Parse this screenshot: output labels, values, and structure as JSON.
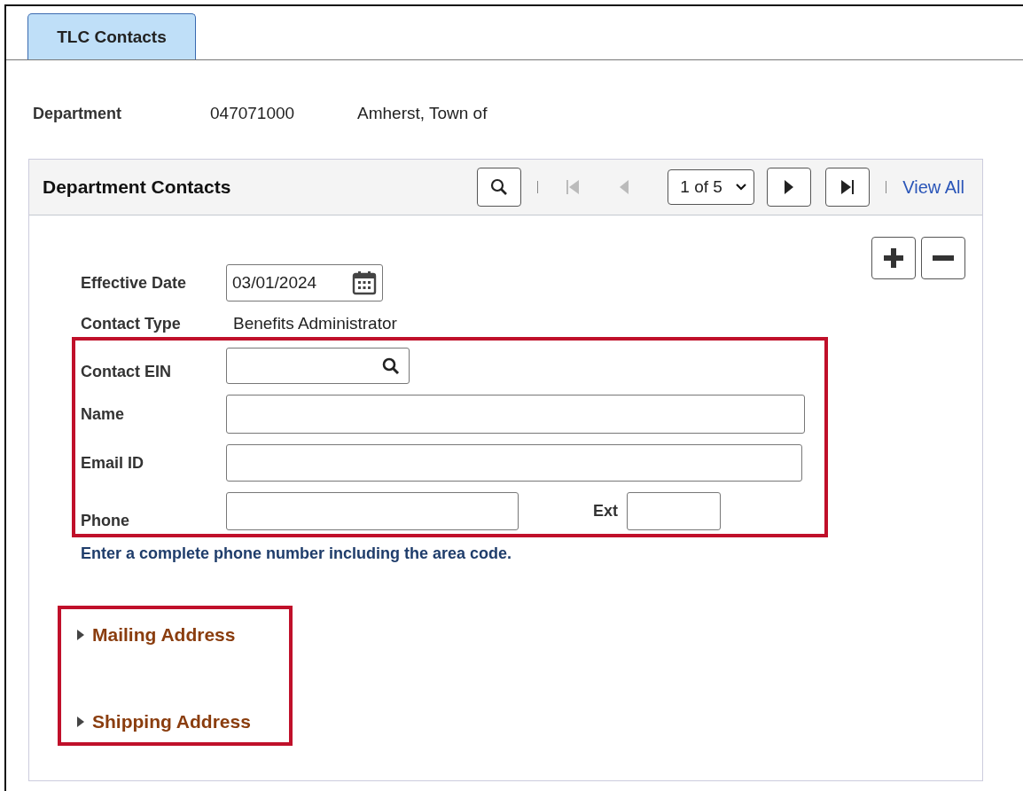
{
  "tab": {
    "label": "TLC Contacts",
    "selected": true
  },
  "department": {
    "label": "Department",
    "code": "047071000",
    "name": "Amherst, Town of"
  },
  "panel": {
    "title": "Department Contacts",
    "page": "1 of 5",
    "view_all": "View All",
    "nav_buttons": [
      {
        "kind": "first",
        "disabled": true
      },
      {
        "kind": "prev",
        "disabled": true
      },
      {
        "kind": "select"
      },
      {
        "kind": "next",
        "disabled": false
      },
      {
        "kind": "last",
        "disabled": false
      }
    ]
  },
  "effective_date": {
    "label": "Effective Date",
    "value": "03/01/2024"
  },
  "contact_type": {
    "label": "Contact Type",
    "value": "Benefits Administrator"
  },
  "contact_fields": [
    {
      "kind": "lookup",
      "label": "Contact EIN"
    },
    {
      "kind": "text",
      "label": "Name"
    },
    {
      "kind": "text",
      "label": "Email ID"
    },
    {
      "kind": "phone",
      "label": "Phone",
      "ext_label": "Ext"
    }
  ],
  "hint": "Enter a complete phone number including the area code.",
  "sections": [
    {
      "label": "Mailing Address",
      "expanded": false
    },
    {
      "label": "Shipping Address",
      "expanded": false
    }
  ]
}
